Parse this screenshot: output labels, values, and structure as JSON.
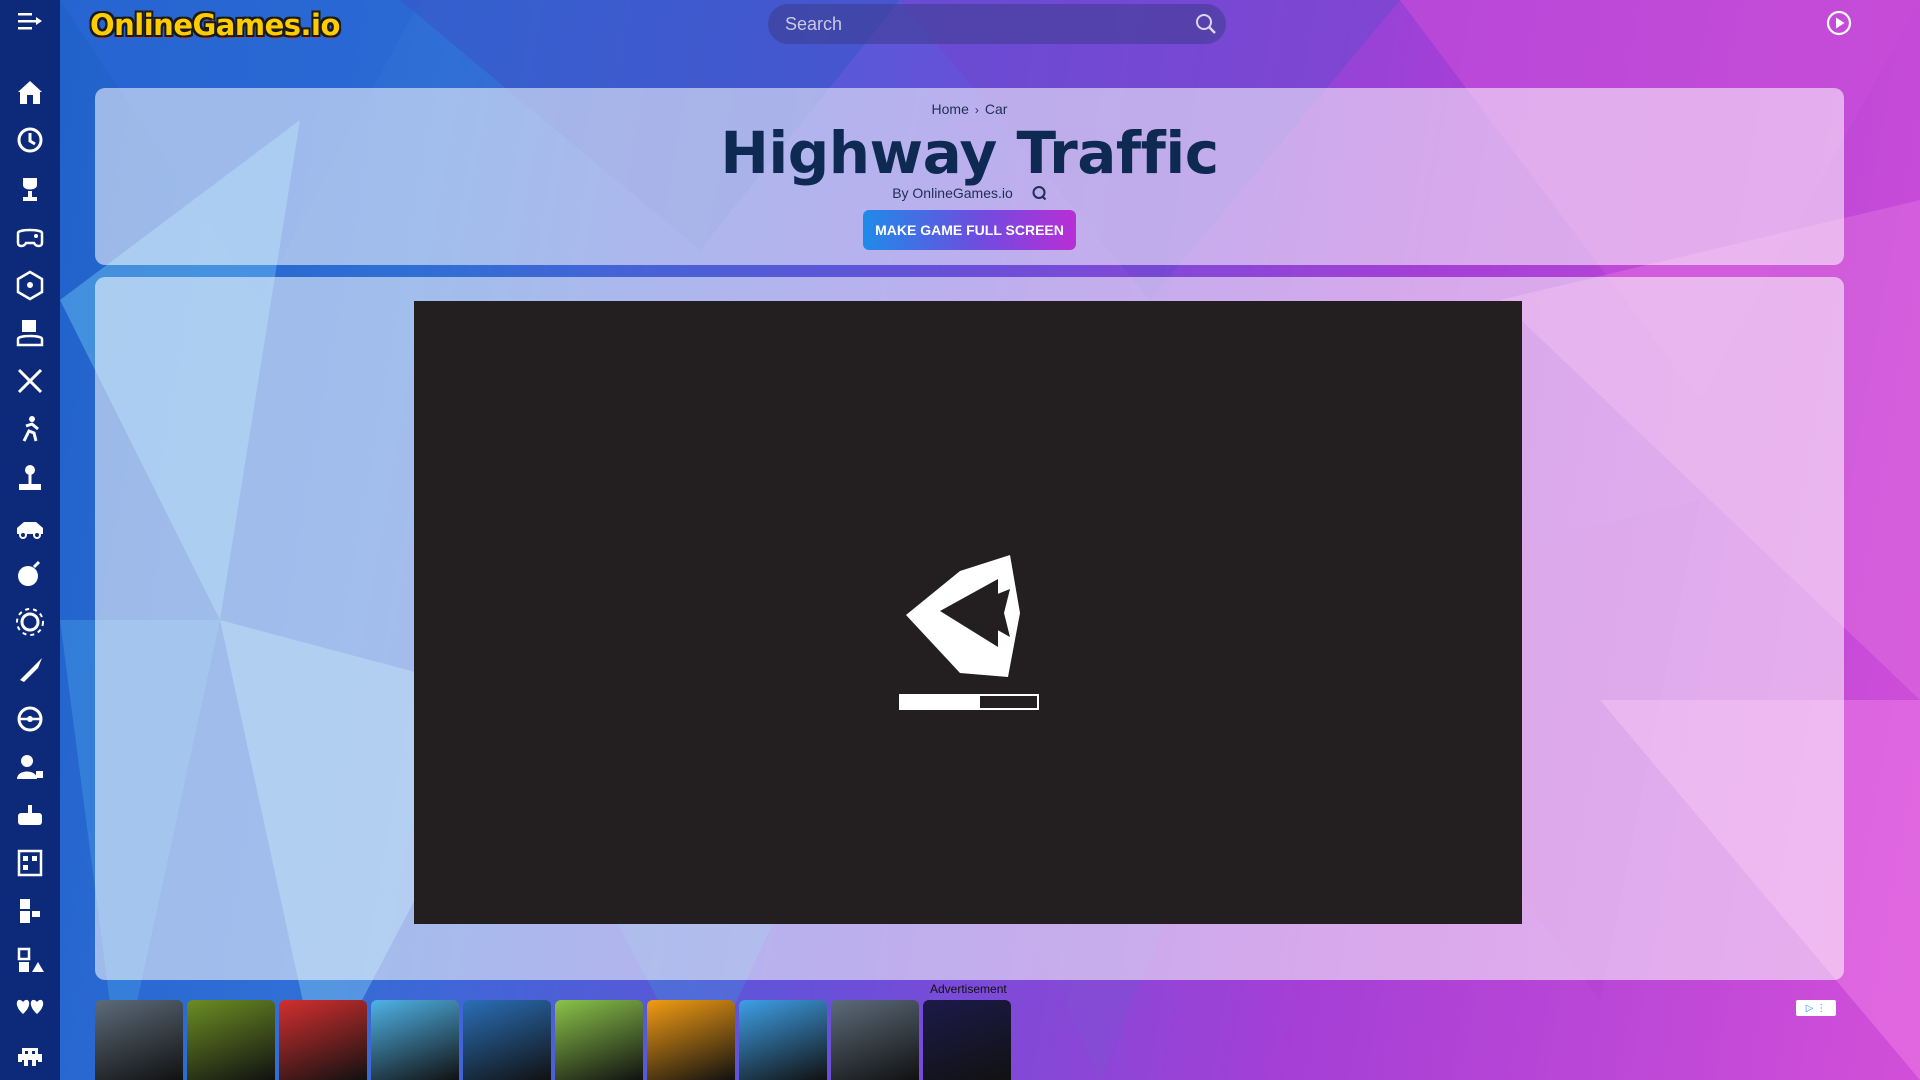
{
  "logo": {
    "text": "OnlineGames.io"
  },
  "search": {
    "placeholder": "Search"
  },
  "breadcrumb": {
    "home": "Home",
    "sep": "›",
    "category": "Car"
  },
  "game": {
    "title": "Highway Traffic",
    "author": "By OnlineGames.io",
    "fullscreen_label": "MAKE GAME FULL SCREEN",
    "loading_progress": 0.58
  },
  "ad": {
    "label": "Advertisement"
  },
  "sidebar_icons": [
    "home-icon",
    "history-icon",
    "trophy-icon",
    "gamepad-icon",
    "dice-icon",
    "multiplayer-icon",
    "swords-icon",
    "runner-icon",
    "joystick-icon",
    "racing-car-icon",
    "bomb-icon",
    "gear-icon",
    "rocket-icon",
    "steering-wheel-icon",
    "puzzle-person-icon",
    "controller-icon",
    "building-icon",
    "tetris-icon",
    "pieces-icon",
    "hearts-icon",
    "space-invader-icon"
  ],
  "ad_tiles": [
    {
      "name": "car-game-thumb",
      "color": "#5c6b7a"
    },
    {
      "name": "temple-run-thumb",
      "color": "#6b8e23"
    },
    {
      "name": "among-us-thumb",
      "color": "#d32f2f"
    },
    {
      "name": "stumble-thumb",
      "color": "#4fb3e8"
    },
    {
      "name": "pool-thumb",
      "color": "#2a6fb8"
    },
    {
      "name": "talking-tom-thumb",
      "color": "#8bc34a"
    },
    {
      "name": "moto-thumb",
      "color": "#f39c12"
    },
    {
      "name": "snake-thumb",
      "color": "#3ea0e8"
    },
    {
      "name": "car-game-2-thumb",
      "color": "#5c6b7a"
    },
    {
      "name": "tic-tac-toe-thumb",
      "color": "#1c1a4a"
    }
  ],
  "colors": {
    "sidebar": "#0d2a7a",
    "title": "#0e2a52",
    "frame": "#231f20"
  }
}
